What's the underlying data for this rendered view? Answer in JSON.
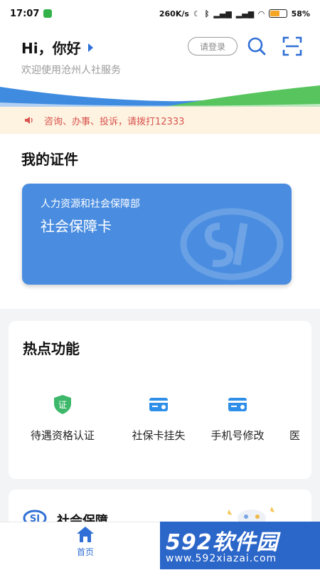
{
  "status_bar": {
    "time": "17:07",
    "speed": "260K/s",
    "battery": "58",
    "battery_unit": "%"
  },
  "header": {
    "greeting": "Hi，你好",
    "subtitle": "欢迎使用沧州人社服务",
    "login_label": "请登录"
  },
  "notice": {
    "text": "咨询、办事、投诉，请拨打12333"
  },
  "certificates": {
    "title": "我的证件",
    "card": {
      "org": "人力资源和社会保障部",
      "name": "社会保障卡"
    }
  },
  "hot": {
    "title": "热点功能",
    "items": [
      {
        "label": "待遇资格认证",
        "icon": "shield-check-icon"
      },
      {
        "label": "社保卡挂失",
        "icon": "card-icon"
      },
      {
        "label": "手机号修改",
        "icon": "card-icon"
      },
      {
        "label": "医",
        "icon": ""
      }
    ]
  },
  "second_section": {
    "title": "社会保障"
  },
  "tabbar": {
    "home_label": "首页"
  },
  "watermark": {
    "brand": "592软件园",
    "url": "www.592xiazai.com"
  },
  "colors": {
    "accent": "#2f6fd6",
    "card": "#4a8de0",
    "notice_bg": "#fdf3e0",
    "notice_text": "#d9534f"
  }
}
